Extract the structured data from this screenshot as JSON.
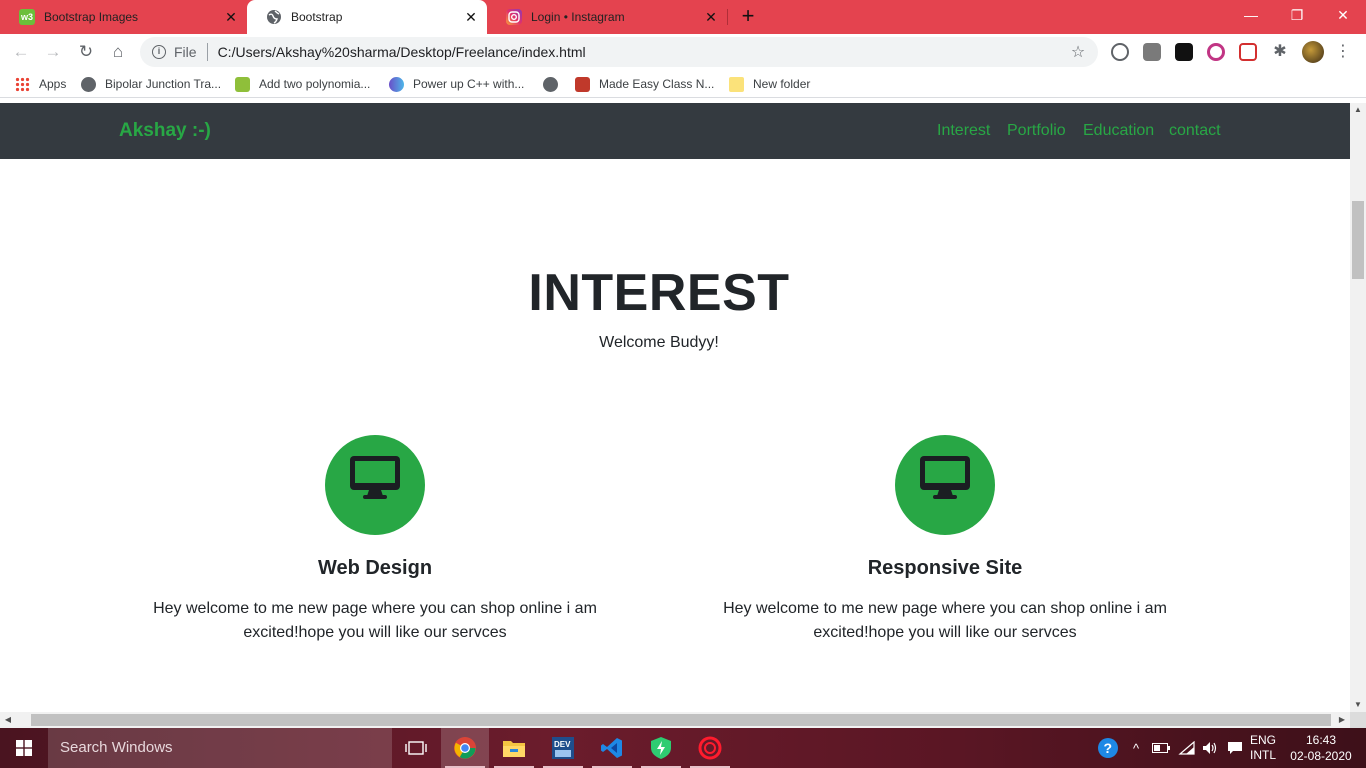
{
  "browser": {
    "tabs": [
      {
        "title": "Bootstrap Images",
        "favicon": "w3schools-icon",
        "active": false
      },
      {
        "title": "Bootstrap",
        "favicon": "globe-icon",
        "active": true
      },
      {
        "title": "Login • Instagram",
        "favicon": "instagram-icon",
        "active": false
      }
    ],
    "w3_favicon_text": "w3",
    "omnibox": {
      "scheme_label": "File",
      "url": "C:/Users/Akshay%20sharma/Desktop/Freelance/index.html"
    },
    "bookmarks": [
      {
        "label": "Apps",
        "icon": "apps-grid-icon"
      },
      {
        "label": "Bipolar Junction Tra...",
        "icon": "globe-icon"
      },
      {
        "label": "Add two polynomia...",
        "icon": "plant-icon"
      },
      {
        "label": "Power up C++ with...",
        "icon": "wave-icon"
      },
      {
        "label": "",
        "icon": "globe-icon"
      },
      {
        "label": "Made Easy Class N...",
        "icon": "rocket-icon"
      },
      {
        "label": "New folder",
        "icon": "folder-icon"
      }
    ]
  },
  "site": {
    "brand": "Akshay :-)",
    "nav_links": [
      "Interest",
      "Portfolio",
      "Education",
      "contact"
    ],
    "hero": {
      "title": "INTEREST",
      "subtitle": "Welcome Budyy!"
    },
    "features": [
      {
        "icon": "desktop-monitor-icon",
        "title": "Web Design",
        "text": "Hey welcome to me new page where you can shop online i am excited!hope you will like our servces"
      },
      {
        "icon": "desktop-monitor-icon",
        "title": "Responsive Site",
        "text": "Hey welcome to me new page where you can shop online i am excited!hope you will like our servces"
      }
    ],
    "colors": {
      "accent": "#28a745",
      "navbar": "#343a40",
      "text": "#212529"
    }
  },
  "taskbar": {
    "search_placeholder": "Search Windows",
    "apps": [
      "task-view-icon",
      "chrome-icon",
      "file-explorer-icon",
      "dev-cpp-icon",
      "vscode-icon",
      "vpn-shield-icon",
      "opera-icon"
    ],
    "tray": {
      "language_line1": "ENG",
      "language_line2": "INTL",
      "time": "16:43",
      "date": "02-08-2020"
    }
  }
}
